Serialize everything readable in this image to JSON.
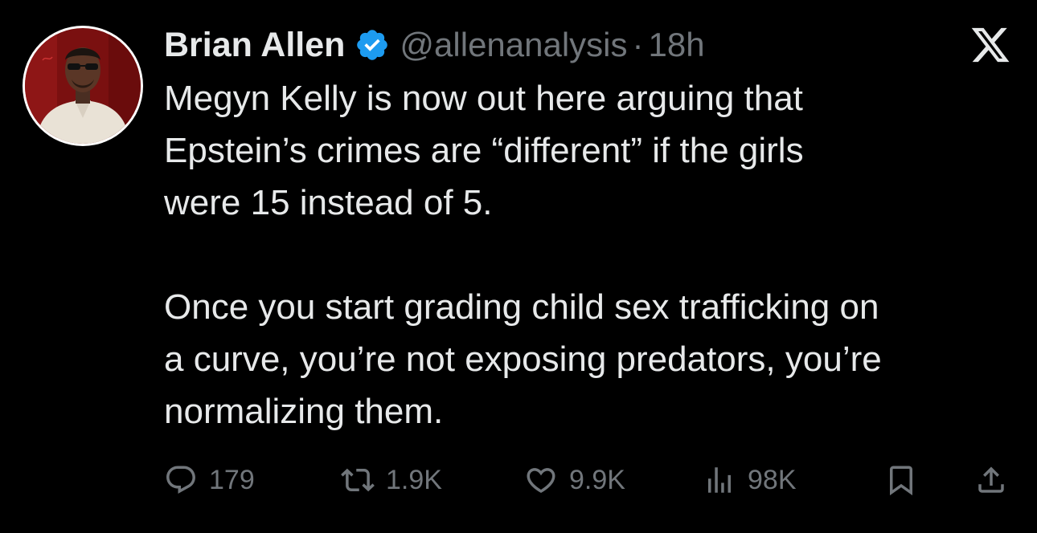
{
  "author": {
    "display_name": "Brian Allen",
    "handle": "@allenanalysis",
    "separator": "·",
    "timestamp": "18h",
    "verified_badge_icon": "verified-badge-icon",
    "verified_color": "#1d9bf0"
  },
  "tweet": {
    "paragraphs": [
      "Megyn Kelly is now out here arguing that\nEpstein’s crimes are “different” if the girls\nwere 15 instead of 5.",
      "Once you start grading child sex trafficking on\na curve, you’re not exposing predators, you’re\nnormalizing them."
    ]
  },
  "actions": {
    "reply": {
      "icon": "reply-bubble-icon",
      "count": "179"
    },
    "repost": {
      "icon": "repost-icon",
      "count": "1.9K"
    },
    "like": {
      "icon": "heart-icon",
      "count": "9.9K"
    },
    "views": {
      "icon": "views-chart-icon",
      "count": "98K"
    },
    "bookmark": {
      "icon": "bookmark-icon"
    },
    "share": {
      "icon": "share-icon"
    }
  },
  "brand": {
    "logo_icon": "x-logo-icon"
  },
  "colors": {
    "background": "#000000",
    "primary_text": "#e7e9ea",
    "secondary_text": "#71767b"
  }
}
